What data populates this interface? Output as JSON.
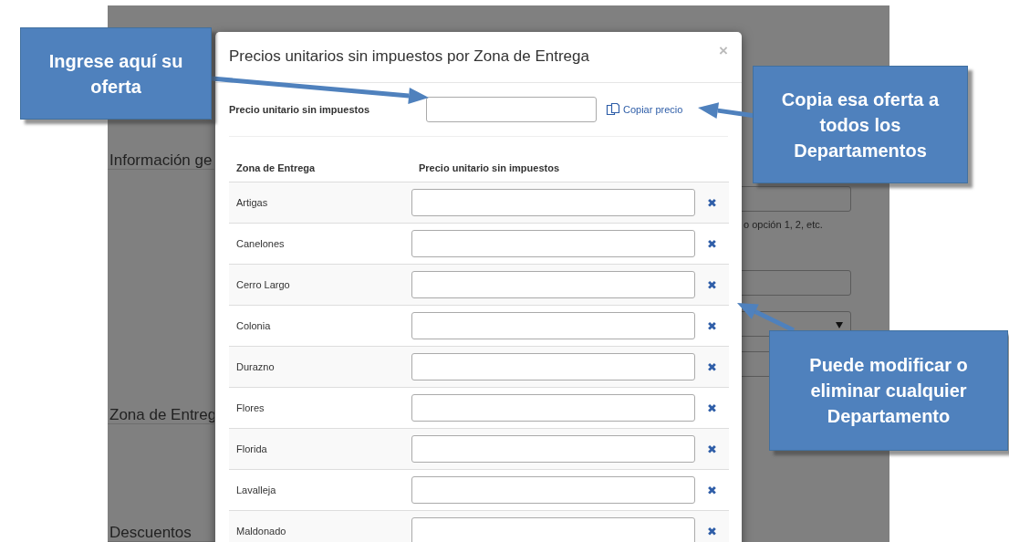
{
  "background_page": {
    "labels": [
      "Información ge",
      "Zona de Entreg",
      "Descuentos"
    ],
    "hint": "o opción 1, 2, etc."
  },
  "modal": {
    "title": "Precios unitarios sin impuestos por Zona de Entrega",
    "close": "×",
    "price_label": "Precio unitario sin impuestos",
    "copy_link": "Copiar precio",
    "table": {
      "columns": [
        "Zona de Entrega",
        "Precio unitario sin impuestos"
      ],
      "rows": [
        {
          "zone": "Artigas",
          "remove": "✖"
        },
        {
          "zone": "Canelones",
          "remove": "✖"
        },
        {
          "zone": "Cerro Largo",
          "remove": "✖"
        },
        {
          "zone": "Colonia",
          "remove": "✖"
        },
        {
          "zone": "Durazno",
          "remove": "✖"
        },
        {
          "zone": "Flores",
          "remove": "✖"
        },
        {
          "zone": "Florida",
          "remove": "✖"
        },
        {
          "zone": "Lavalleja",
          "remove": "✖"
        },
        {
          "zone": "Maldonado",
          "remove": "✖"
        }
      ]
    }
  },
  "callouts": [
    {
      "text": "Ingrese aquí su oferta"
    },
    {
      "text": "Copia esa oferta a todos los Departamentos"
    },
    {
      "text": "Puede modificar o eliminar cualquier Departamento"
    }
  ]
}
